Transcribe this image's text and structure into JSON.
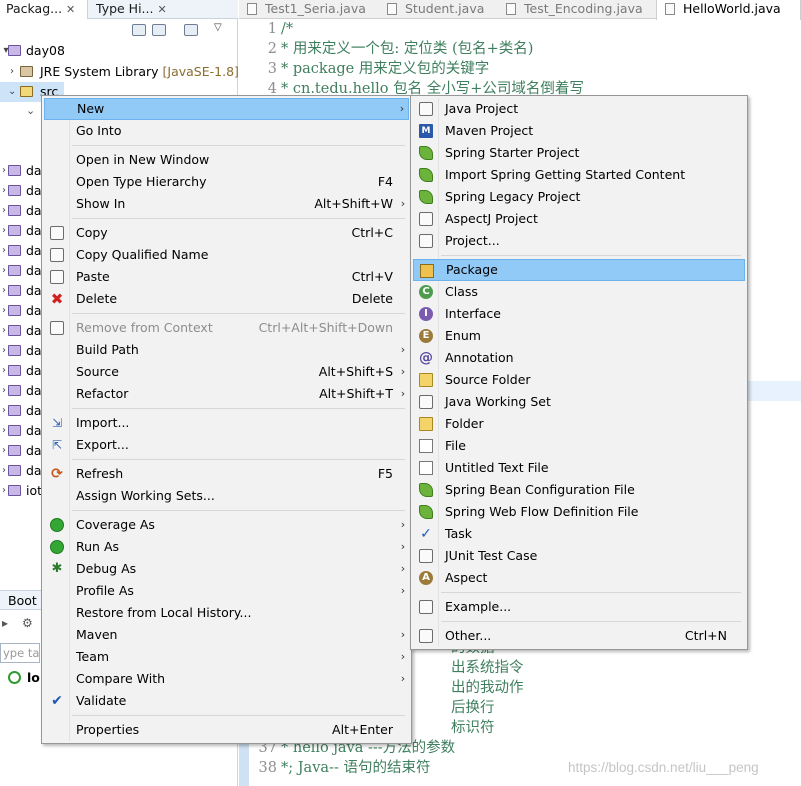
{
  "explorer": {
    "tabs": [
      {
        "label": "Packag..."
      },
      {
        "label": "Type Hi..."
      }
    ],
    "tree": [
      {
        "label": "day08"
      },
      {
        "label": "JRE System Library",
        "tag": "[JavaSE-1.8]"
      },
      {
        "label": "src"
      }
    ],
    "collapsed_rows": [
      "da",
      "da",
      "da",
      "da",
      "da",
      "da",
      "da",
      "da",
      "da",
      "da",
      "da",
      "da",
      "da",
      "da",
      "da",
      "da"
    ],
    "last_row": "iot",
    "bottom_tab": "Boot",
    "filter_placeholder": "ype tag",
    "boot_item": "lo"
  },
  "editor": {
    "tabs": [
      {
        "label": "Test1_Seria.java"
      },
      {
        "label": "Student.java"
      },
      {
        "label": "Test_Encoding.java"
      },
      {
        "label": "HelloWorld.java"
      }
    ],
    "top_lines": [
      {
        "n": "1",
        "text": "/*"
      },
      {
        "n": "2",
        "text": "* 用来定义一个包: 定位类 (包名+类名)"
      },
      {
        "n": "3",
        "text": "* package 用来定义包的关键字"
      },
      {
        "n": "4",
        "text": "* cn.tedu.hello 包名 全小写+公司域名倒着写"
      }
    ],
    "bottom_lines": [
      {
        "n": "",
        "text": "的数据"
      },
      {
        "n": "",
        "text": "出系统指令"
      },
      {
        "n": "",
        "text": "出的我动作"
      },
      {
        "n": "",
        "text": "后换行"
      },
      {
        "n": "",
        "text": "标识符"
      },
      {
        "n": "37",
        "text": "* hello java ---方法的参数"
      },
      {
        "n": "38",
        "text": "*; Java-- 语句的结束符"
      }
    ]
  },
  "context_menu": {
    "items": [
      {
        "label": "New",
        "arrow": true,
        "selected": true
      },
      {
        "label": "Go Into"
      },
      {
        "sep": true
      },
      {
        "label": "Open in New Window"
      },
      {
        "label": "Open Type Hierarchy",
        "accel": "F4"
      },
      {
        "label": "Show In",
        "accel": "Alt+Shift+W",
        "arrow": true
      },
      {
        "sep": true
      },
      {
        "label": "Copy",
        "accel": "Ctrl+C",
        "icon": "copy-icon"
      },
      {
        "label": "Copy Qualified Name",
        "icon": "copy-qualified-icon"
      },
      {
        "label": "Paste",
        "accel": "Ctrl+V",
        "icon": "paste-icon"
      },
      {
        "label": "Delete",
        "accel": "Delete",
        "icon": "delete-icon"
      },
      {
        "sep": true
      },
      {
        "label": "Remove from Context",
        "accel": "Ctrl+Alt+Shift+Down",
        "disabled": true,
        "icon": "remove-context-icon"
      },
      {
        "label": "Build Path",
        "arrow": true
      },
      {
        "label": "Source",
        "accel": "Alt+Shift+S",
        "arrow": true
      },
      {
        "label": "Refactor",
        "accel": "Alt+Shift+T",
        "arrow": true
      },
      {
        "sep": true
      },
      {
        "label": "Import...",
        "icon": "import-icon"
      },
      {
        "label": "Export...",
        "icon": "export-icon"
      },
      {
        "sep": true
      },
      {
        "label": "Refresh",
        "accel": "F5",
        "icon": "refresh-icon"
      },
      {
        "label": "Assign Working Sets..."
      },
      {
        "sep": true
      },
      {
        "label": "Coverage As",
        "arrow": true,
        "icon": "coverage-icon"
      },
      {
        "label": "Run As",
        "arrow": true,
        "icon": "run-icon"
      },
      {
        "label": "Debug As",
        "arrow": true,
        "icon": "debug-icon"
      },
      {
        "label": "Profile As",
        "arrow": true
      },
      {
        "label": "Restore from Local History..."
      },
      {
        "label": "Maven",
        "arrow": true
      },
      {
        "label": "Team",
        "arrow": true
      },
      {
        "label": "Compare With",
        "arrow": true
      },
      {
        "label": "Validate",
        "icon": "validate-check-icon"
      },
      {
        "sep": true
      },
      {
        "label": "Properties",
        "accel": "Alt+Enter"
      }
    ]
  },
  "submenu": {
    "items": [
      {
        "label": "Java Project",
        "icon": "java-project-icon"
      },
      {
        "label": "Maven Project",
        "icon": "maven-project-icon"
      },
      {
        "label": "Spring Starter Project",
        "icon": "spring-starter-icon"
      },
      {
        "label": "Import Spring Getting Started Content",
        "icon": "spring-import-icon"
      },
      {
        "label": "Spring Legacy Project",
        "icon": "spring-legacy-icon"
      },
      {
        "label": "AspectJ Project",
        "icon": "aspectj-project-icon"
      },
      {
        "label": "Project...",
        "icon": "project-icon"
      },
      {
        "sep": true
      },
      {
        "label": "Package",
        "icon": "package-icon",
        "selected": true
      },
      {
        "label": "Class",
        "icon": "class-icon"
      },
      {
        "label": "Interface",
        "icon": "interface-icon"
      },
      {
        "label": "Enum",
        "icon": "enum-icon"
      },
      {
        "label": "Annotation",
        "icon": "annotation-icon"
      },
      {
        "label": "Source Folder",
        "icon": "source-folder-icon"
      },
      {
        "label": "Java Working Set",
        "icon": "java-working-set-icon"
      },
      {
        "label": "Folder",
        "icon": "folder-icon"
      },
      {
        "label": "File",
        "icon": "file-icon"
      },
      {
        "label": "Untitled Text File",
        "icon": "untitled-text-file-icon"
      },
      {
        "label": "Spring Bean Configuration File",
        "icon": "spring-bean-icon"
      },
      {
        "label": "Spring Web Flow Definition File",
        "icon": "spring-webflow-icon"
      },
      {
        "label": "Task",
        "icon": "task-icon"
      },
      {
        "label": "JUnit Test Case",
        "icon": "junit-icon"
      },
      {
        "label": "Aspect",
        "icon": "aspect-icon"
      },
      {
        "sep": true
      },
      {
        "label": "Example...",
        "icon": "example-icon"
      },
      {
        "sep": true
      },
      {
        "label": "Other...",
        "accel": "Ctrl+N",
        "icon": "other-icon"
      }
    ]
  },
  "watermark": "https://blog.csdn.net/liu___peng"
}
